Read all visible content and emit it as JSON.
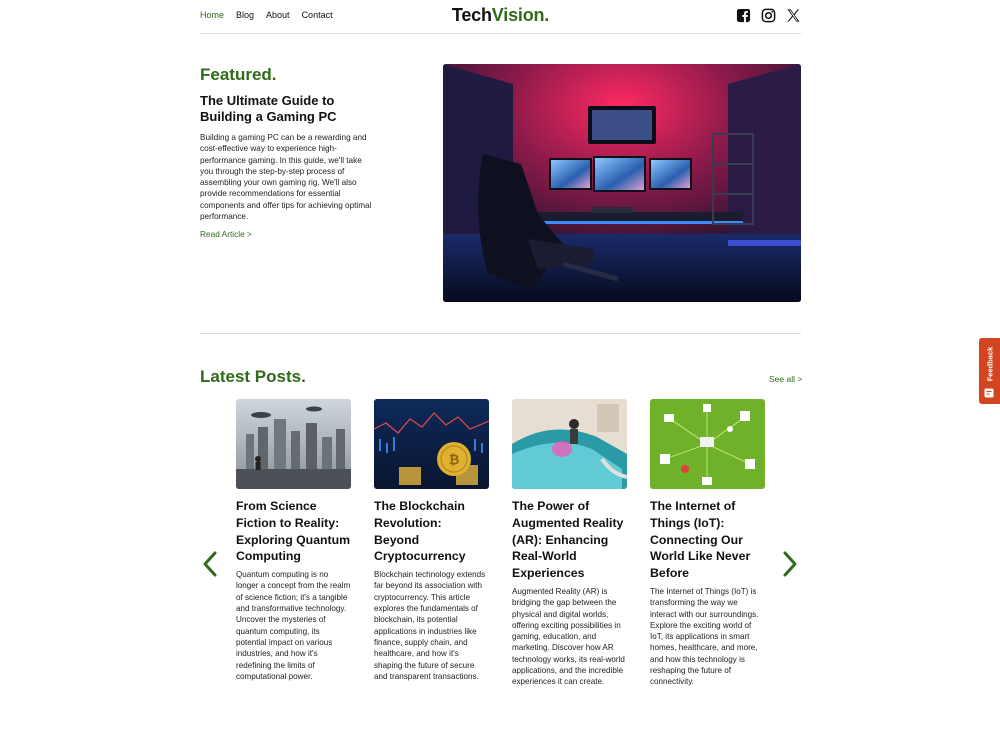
{
  "nav": {
    "items": [
      {
        "label": "Home",
        "active": true
      },
      {
        "label": "Blog",
        "active": false
      },
      {
        "label": "About",
        "active": false
      },
      {
        "label": "Contact",
        "active": false
      }
    ]
  },
  "logo": {
    "part1": "Tech",
    "part2": "Vision."
  },
  "social": {
    "icons": [
      "facebook-icon",
      "instagram-icon",
      "x-icon"
    ]
  },
  "featured": {
    "heading": "Featured.",
    "title": "The Ultimate Guide to Building a Gaming PC",
    "description": "Building a gaming PC can be a rewarding and cost-effective way to experience high-performance gaming. In this guide, we'll take you through the step-by-step process of assembling your own gaming rig. We'll also provide recommendations for essential components and offer tips for achieving optimal performance.",
    "link": "Read Article >"
  },
  "latest": {
    "heading": "Latest Posts.",
    "see_all": "See all >",
    "posts": [
      {
        "title": "From Science Fiction to Reality: Exploring Quantum Computing",
        "description": "Quantum computing is no longer a concept from the realm of science fiction; it's a tangible and transformative technology. Uncover the mysteries of quantum computing, its potential impact on various industries, and how it's redefining the limits of computational power."
      },
      {
        "title": "The Blockchain Revolution: Beyond Cryptocurrency",
        "description": "Blockchain technology extends far beyond its association with cryptocurrency. This article explores the fundamentals of blockchain, its potential applications in industries like finance, supply chain, and healthcare, and how it's shaping the future of secure and transparent transactions."
      },
      {
        "title": "The Power of Augmented Reality (AR): Enhancing Real-World Experiences",
        "description": "Augmented Reality (AR) is bridging the gap between the physical and digital worlds, offering exciting possibilities in gaming, education, and marketing. Discover how AR technology works, its real-world applications, and the incredible experiences it can create."
      },
      {
        "title": "The Internet of Things (IoT): Connecting Our World Like Never Before",
        "description": "The Internet of Things (IoT) is transforming the way we interact with our surroundings. Explore the exciting world of IoT, its applications in smart homes, healthcare, and more, and how this technology is reshaping the future of connectivity."
      }
    ]
  },
  "feedback": {
    "label": "Feedback"
  },
  "colors": {
    "accent": "#2f6b1a",
    "feedback": "#d34420"
  }
}
